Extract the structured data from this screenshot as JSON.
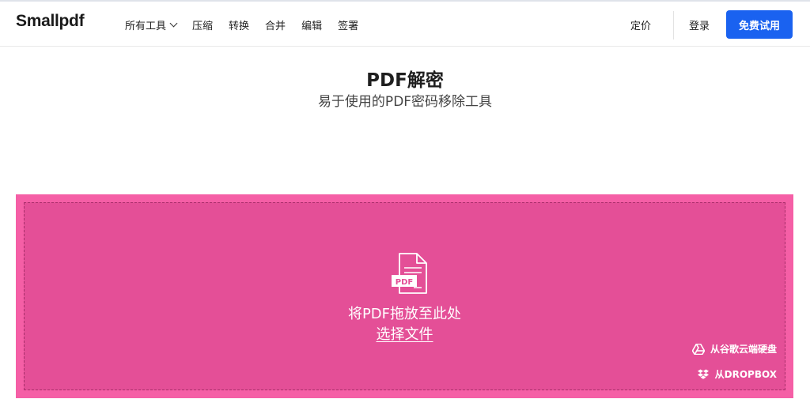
{
  "header": {
    "logo": "Smallpdf",
    "nav": [
      {
        "label": "所有工具",
        "has_dropdown": true
      },
      {
        "label": "压缩"
      },
      {
        "label": "转换"
      },
      {
        "label": "合并"
      },
      {
        "label": "编辑"
      },
      {
        "label": "签署"
      }
    ],
    "pricing": "定价",
    "login": "登录",
    "trial": "免费试用"
  },
  "main": {
    "title": "PDF解密",
    "subtitle": "易于使用的PDF密码移除工具"
  },
  "dropzone": {
    "icon_label": "PDF",
    "icon": "pdf-file-icon",
    "drop_text": "将PDF拖放至此处",
    "choose_file": "选择文件",
    "sources": [
      {
        "label": "从谷歌云端硬盘",
        "icon": "google-drive-icon"
      },
      {
        "label": "从DROPBOX",
        "icon": "dropbox-icon"
      }
    ]
  },
  "colors": {
    "accent": "#1a62f0",
    "dropzone_bg": "#e44f97",
    "dropzone_border": "#f55fa6"
  }
}
